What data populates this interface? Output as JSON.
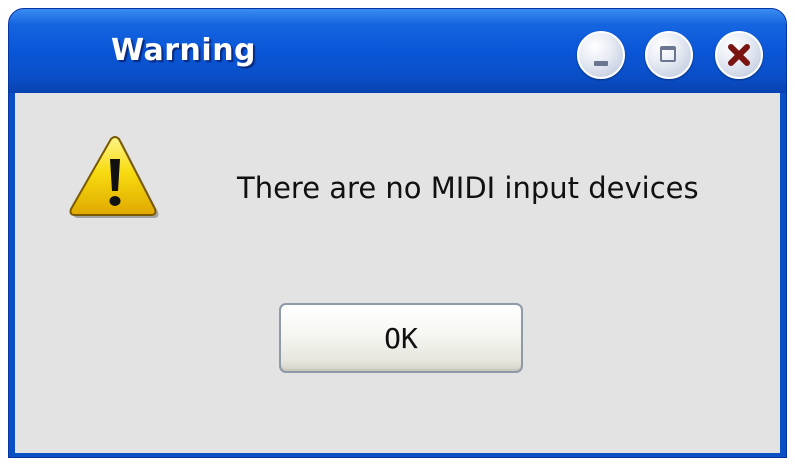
{
  "window": {
    "title": "Warning",
    "controls": {
      "minimize": "minimize",
      "maximize": "maximize",
      "close": "close"
    }
  },
  "dialog": {
    "icon": "warning-icon",
    "message": "There are no MIDI input devices",
    "ok_label": "OK"
  },
  "colors": {
    "titlebar": "#0a56d8",
    "client_background": "#e3e3e3",
    "close_glyph": "#7a1410",
    "warning_yellow": "#f5d400"
  }
}
